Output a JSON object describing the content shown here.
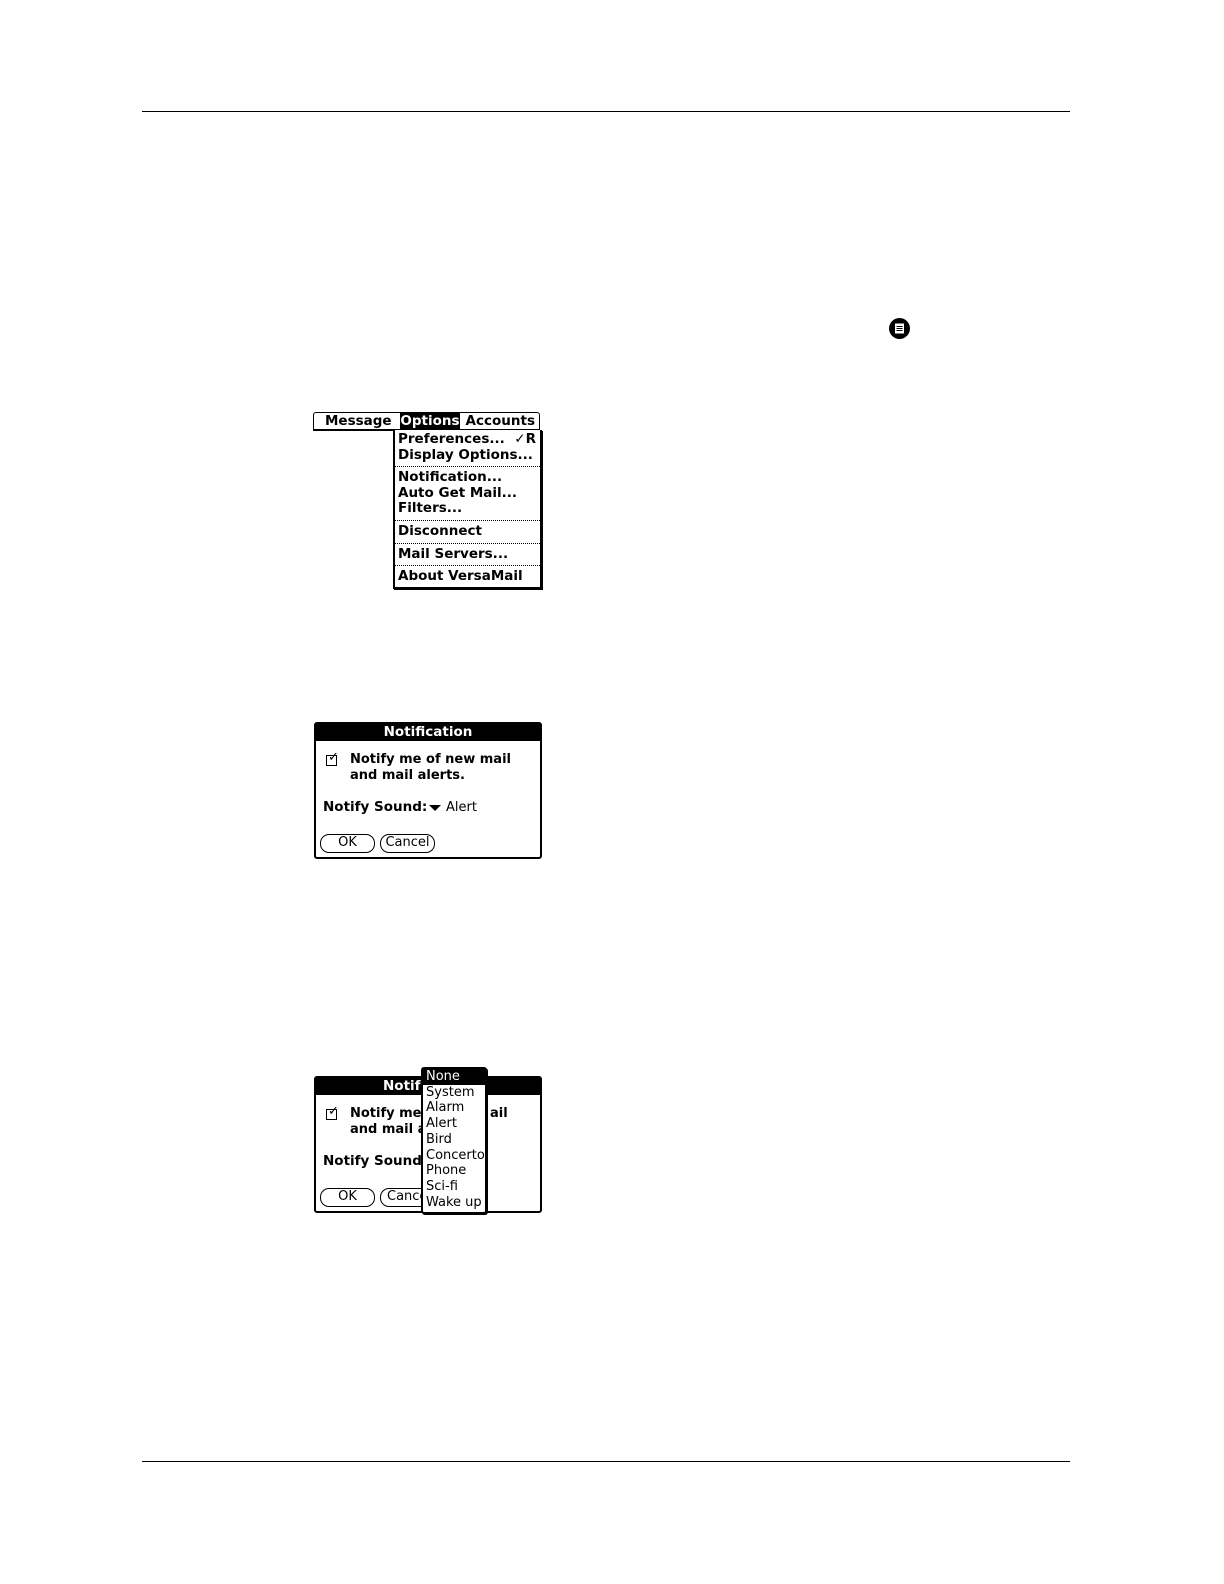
{
  "menubar": {
    "titles": [
      "Message",
      "Options",
      "Accounts"
    ],
    "active": "Options"
  },
  "options_menu": {
    "items": [
      {
        "label": "Preferences...",
        "shortcut": "✓R"
      },
      {
        "label": "Display Options..."
      },
      {
        "label": "Notification..."
      },
      {
        "label": "Auto Get Mail..."
      },
      {
        "label": "Filters..."
      },
      {
        "label": "Disconnect"
      },
      {
        "label": "Mail Servers..."
      },
      {
        "label": "About VersaMail"
      }
    ]
  },
  "notification_dialog": {
    "title": "Notification",
    "checkbox_label_line1": "Notify me of new mail",
    "checkbox_label_line2": "and mail alerts.",
    "checkbox_checked": true,
    "notify_sound_label": "Notify Sound:",
    "notify_sound_value": "Alert",
    "ok_label": "OK",
    "cancel_label": "Cancel"
  },
  "notification_dialog_partial": {
    "title": "Notif",
    "checkbox_label_line1_left": "Notify me",
    "checkbox_label_line1_right": "ail",
    "checkbox_label_line2": "and mail a",
    "notify_sound_label": "Notify Sound:",
    "ok_label": "OK",
    "cancel_label": "Cance"
  },
  "sound_popup": {
    "options": [
      "None",
      "System",
      "Alarm",
      "Alert",
      "Bird",
      "Concerto",
      "Phone",
      "Sci-fi",
      "Wake up"
    ],
    "selected": "None"
  },
  "icons": {
    "menu": "menu-icon"
  }
}
